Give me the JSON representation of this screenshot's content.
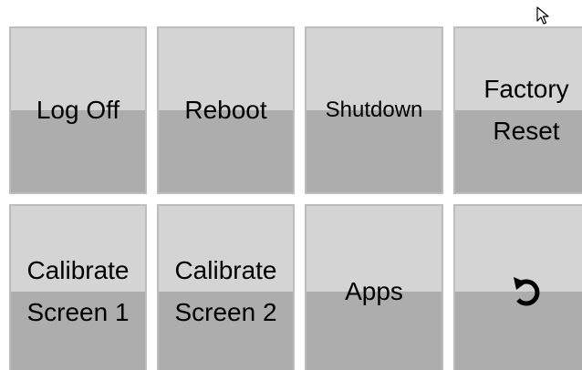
{
  "buttons": {
    "log_off": "Log Off",
    "reboot": "Reboot",
    "shutdown": "Shutdown",
    "factory_reset": [
      "Factory",
      "Reset"
    ],
    "calibrate_screen_1": [
      "Calibrate",
      "Screen 1"
    ],
    "calibrate_screen_2": [
      "Calibrate",
      "Screen 2"
    ],
    "apps": "Apps",
    "back_icon": "undo-arrow-icon"
  },
  "colors": {
    "tile_top": "#d4d4d4",
    "tile_bottom": "#adadad",
    "tile_border": "#bdbdbd",
    "text": "#000000"
  }
}
